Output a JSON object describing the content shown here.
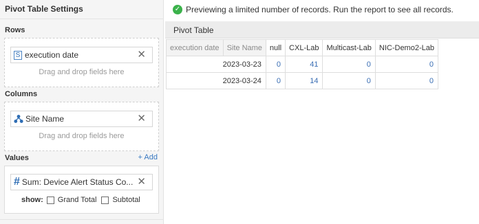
{
  "settings": {
    "title": "Pivot Table Settings",
    "rows": {
      "label": "Rows",
      "field": {
        "icon": "string-type-icon",
        "icon_glyph": "S",
        "label": "execution date"
      },
      "hint": "Drag and drop fields here"
    },
    "columns": {
      "label": "Columns",
      "field": {
        "icon": "site-hierarchy-icon",
        "label": "Site Name"
      },
      "hint": "Drag and drop fields here"
    },
    "values": {
      "label": "Values",
      "add_label": "+ Add",
      "field": {
        "icon": "number-type-icon",
        "icon_glyph": "#",
        "label": "Sum: Device Alert Status Co..."
      },
      "show_label": "show:",
      "grand_total_label": "Grand Total",
      "subtotal_label": "Subtotal",
      "grand_total_checked": false,
      "subtotal_checked": false
    }
  },
  "banner": {
    "icon": "check-circle-icon",
    "text": "Previewing a limited number of records. Run the report to see all records."
  },
  "pivot": {
    "title": "Pivot Table",
    "row_headers": [
      "execution date",
      "Site Name"
    ],
    "columns": [
      "null",
      "CXL-Lab",
      "Multicast-Lab",
      "NIC-Demo2-Lab"
    ],
    "rows": [
      {
        "label": "2023-03-23",
        "values": [
          "0",
          "41",
          "0",
          "0"
        ]
      },
      {
        "label": "2023-03-24",
        "values": [
          "0",
          "14",
          "0",
          "0"
        ]
      }
    ]
  },
  "colors": {
    "accent": "#3a7ac2",
    "success": "#3bb24b",
    "value_text": "#3a6eb4"
  }
}
